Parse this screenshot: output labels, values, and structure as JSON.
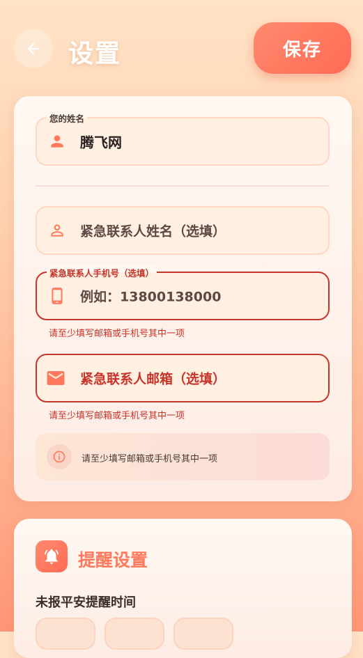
{
  "header": {
    "title": "设置",
    "save_label": "保存"
  },
  "form": {
    "name_label": "您的姓名",
    "name_value": "腾飞网",
    "contact_name_placeholder": "紧急联系人姓名（选填）",
    "contact_phone_label": "紧急联系人手机号（选填）",
    "contact_phone_placeholder": "例如：13800138000",
    "contact_phone_error": "请至少填写邮箱或手机号其中一项",
    "contact_email_placeholder": "紧急联系人邮箱（选填）",
    "contact_email_error": "请至少填写邮箱或手机号其中一项",
    "info_text": "请至少填写邮箱或手机号其中一项"
  },
  "reminder": {
    "title": "提醒设置",
    "subtitle": "未报平安提醒时间"
  },
  "colors": {
    "accent": "#ff7a5c",
    "error": "#c7342a"
  },
  "icons": {
    "back": "arrow-left-icon",
    "person": "person-icon",
    "person_outline": "person-outline-icon",
    "phone": "smartphone-icon",
    "email": "mail-icon",
    "info": "info-icon",
    "bell": "bell-icon"
  }
}
